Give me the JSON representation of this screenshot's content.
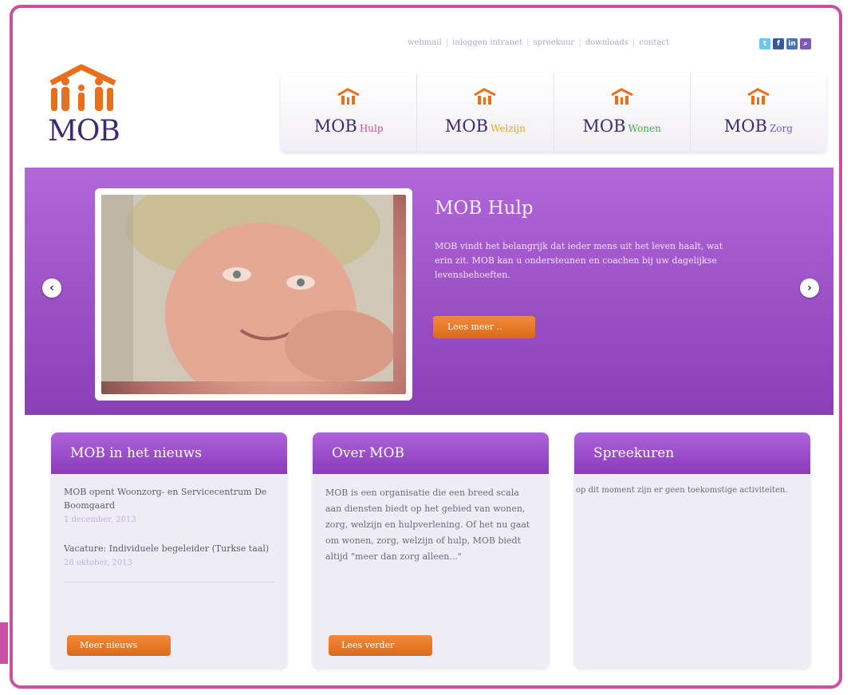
{
  "top_links": [
    "webmail",
    "inloggen intranet",
    "spreekuur",
    "downloads",
    "contact"
  ],
  "social": [
    {
      "name": "twitter",
      "glyph": "t",
      "color": "#6cc7ee"
    },
    {
      "name": "facebook",
      "glyph": "f",
      "color": "#3b5998"
    },
    {
      "name": "linkedin",
      "glyph": "in",
      "color": "#4575b5"
    },
    {
      "name": "search",
      "glyph": "⌕",
      "color": "#7d5ab8"
    }
  ],
  "logo": {
    "name": "MOB"
  },
  "nav": [
    {
      "main": "MOB",
      "sub": "Hulp",
      "color": "#c24f8e"
    },
    {
      "main": "MOB",
      "sub": "Welzijn",
      "color": "#e8a61a"
    },
    {
      "main": "MOB",
      "sub": "Wonen",
      "color": "#3fa94c"
    },
    {
      "main": "MOB",
      "sub": "Zorg",
      "color": "#7a54c0"
    }
  ],
  "hero": {
    "title": "MOB Hulp",
    "description": "MOB vindt het belangrijk dat ieder mens uit het leven haalt, wat erin zit. MOB kan u ondersteunen en coachen bij uw dagelijkse levensbehoeften.",
    "button": "Lees meer ..",
    "prev": "‹",
    "next": "›"
  },
  "boxes": {
    "news": {
      "title": "MOB in het nieuws",
      "items": [
        {
          "title": "MOB opent Woonzorg- en Servicecentrum De Boomgaard",
          "date": "1 december, 2013"
        },
        {
          "title": "Vacature: Individuele begeleider (Turkse taal)",
          "date": "28 oktober, 2013"
        }
      ],
      "button": "Meer nieuws"
    },
    "about": {
      "title": "Over MOB",
      "text": "MOB is een organisatie die een breed scala aan diensten biedt op het gebied van wonen, zorg, welzijn en hulpverlening. Of het nu gaat om wonen, zorg, welzijn of hulp, MOB biedt altijd \"meer dan zorg alleen...\"",
      "button": "Lees verder"
    },
    "hours": {
      "title": "Spreekuren",
      "text": "op dit moment zijn er geen toekomstige activiteiten."
    }
  }
}
